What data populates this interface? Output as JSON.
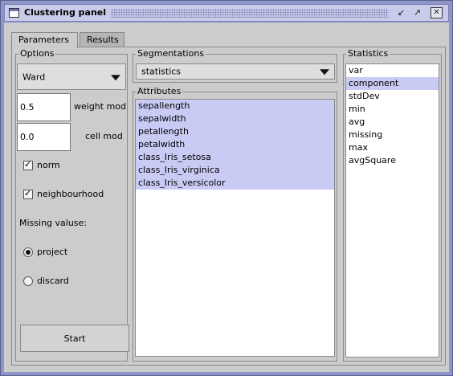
{
  "window": {
    "title": "Clustering panel",
    "icons": [
      "app-window-icon",
      "iconify-icon",
      "maximize-icon",
      "close-icon"
    ]
  },
  "tabs": [
    {
      "label": "Parameters",
      "active": true
    },
    {
      "label": "Results",
      "active": false
    }
  ],
  "options": {
    "title": "Options",
    "method_value": "Ward",
    "weight_value": "0.5",
    "weight_label": "weight mod",
    "cell_value": "0.0",
    "cell_label": "cell mod",
    "norm_label": "norm",
    "norm_checked": true,
    "neighbourhood_label": "neighbourhood",
    "neighbourhood_checked": true,
    "missing_label": "Missing valuse:",
    "project_label": "project",
    "project_selected": true,
    "discard_label": "discard",
    "discard_selected": false,
    "start_label": "Start"
  },
  "segmentations": {
    "title": "Segmentations",
    "selected": "statistics"
  },
  "attributes": {
    "title": "Attributes",
    "items": [
      {
        "label": "sepallength",
        "selected": true
      },
      {
        "label": "sepalwidth",
        "selected": true
      },
      {
        "label": "petallength",
        "selected": true
      },
      {
        "label": "petalwidth",
        "selected": true
      },
      {
        "label": "class_Iris_setosa",
        "selected": true
      },
      {
        "label": "class_Iris_virginica",
        "selected": true
      },
      {
        "label": "class_Iris_versicolor",
        "selected": true
      }
    ]
  },
  "statistics": {
    "title": "Statistics",
    "items": [
      {
        "label": "var",
        "selected": false
      },
      {
        "label": "component",
        "selected": true
      },
      {
        "label": "stdDev",
        "selected": false
      },
      {
        "label": "min",
        "selected": false
      },
      {
        "label": "avg",
        "selected": false
      },
      {
        "label": "missing",
        "selected": false
      },
      {
        "label": "max",
        "selected": false
      },
      {
        "label": "avgSquare",
        "selected": false
      }
    ]
  },
  "colors": {
    "frame": "#8f95c6",
    "titlebar": "#c9cbea",
    "panel": "#cccccc",
    "selection": "#c9cbf5"
  }
}
